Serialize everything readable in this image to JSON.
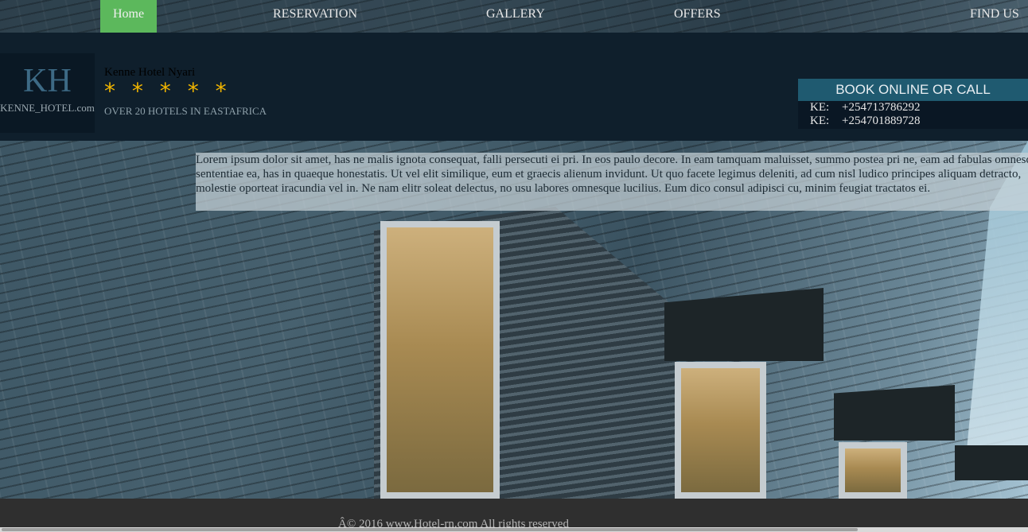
{
  "nav": {
    "items": [
      {
        "label": "Home",
        "active": true
      },
      {
        "label": "RESERVATION"
      },
      {
        "label": "GALLERY"
      },
      {
        "label": "OFFERS"
      },
      {
        "label": "FIND US"
      }
    ],
    "active_color": "#5cb85c"
  },
  "header": {
    "logo_initials": "KH",
    "logo_site": "KENNE_HOTEL.com",
    "hotel_name": "Kenne Hotel Nyari",
    "stars": "* * * * *",
    "tagline": "OVER 20 HOTELS IN EASTAFRICA"
  },
  "booking": {
    "title": "BOOK ONLINE OR CALL",
    "phones": [
      {
        "prefix": "KE:",
        "number": "+254713786292"
      },
      {
        "prefix": "KE:",
        "number": "+254701889728"
      }
    ]
  },
  "intro": {
    "text": "Lorem ipsum dolor sit amet, has ne malis ignota consequat, falli persecuti ei pri. In eos paulo decore. In eam tamquam maluisset, summo postea pri ne, eam ad fabulas omnesque sententiae ea, has in quaeque honestatis. Ut vel elit similique, eum et graecis alienum invidunt. Ut quo facete legimus deleniti, ad cum nisl ludico principes aliquam detracto, molestie oporteat iracundia vel in. Ne nam elitr soleat delectus, no usu labores omnesque lucilius. Eum dico consul adipisci cu, minim feugiat tractatos ei."
  },
  "footer": {
    "copyright": "Â© 2016 www.Hotel-rn.com All rights reserved"
  },
  "colors": {
    "header_bg": "#0f1f2c",
    "book_title_bg": "#1f5a70",
    "star": "#f0b400"
  }
}
